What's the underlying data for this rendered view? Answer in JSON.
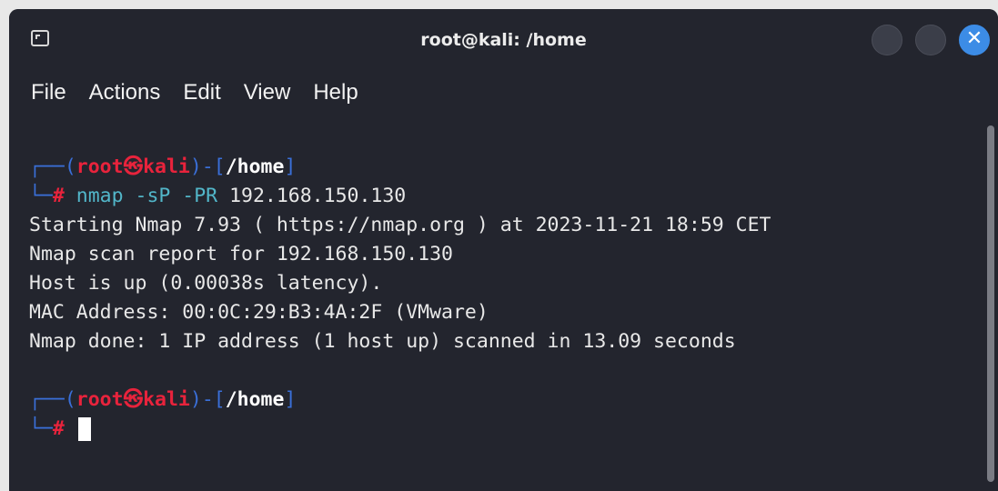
{
  "window": {
    "title": "root@kali: /home",
    "close_label": "✕"
  },
  "menu": [
    "File",
    "Actions",
    "Edit",
    "View",
    "Help"
  ],
  "prompt": {
    "corner_top": "┌──",
    "open_paren": "(",
    "user": "root",
    "at_symbol": "㉿",
    "host": "kali",
    "close_paren": ")-[",
    "path": "/home",
    "close_bracket": "]",
    "corner_bottom": "└─",
    "hash": "#"
  },
  "command": {
    "name": "nmap",
    "flags": " -sP -PR ",
    "target": "192.168.150.130"
  },
  "output": [
    "Starting Nmap 7.93 ( https://nmap.org ) at 2023-11-21 18:59 CET",
    "Nmap scan report for 192.168.150.130",
    "Host is up (0.00038s latency).",
    "MAC Address: 00:0C:29:B3:4A:2F (VMware)",
    "Nmap done: 1 IP address (1 host up) scanned in 13.09 seconds"
  ]
}
